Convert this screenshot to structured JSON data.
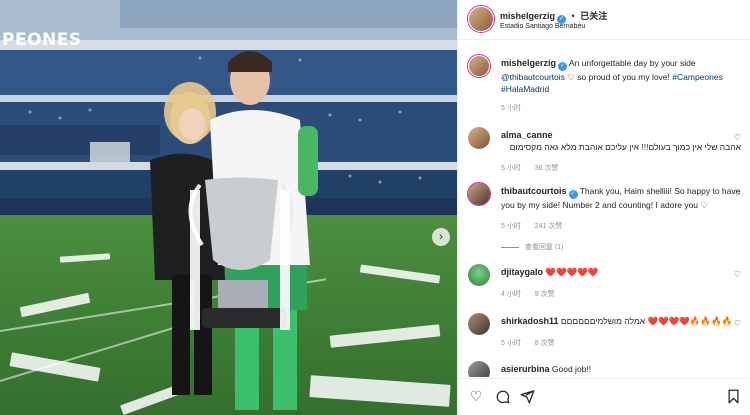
{
  "header": {
    "username": "mishelgerzig",
    "follow_label": "已关注",
    "location": "Estadio Santiago Bernabéu"
  },
  "photo": {
    "banner_text": "PEONES"
  },
  "caption": {
    "username": "mishelgerzig",
    "text": "An unforgettable day by your side",
    "mention": "@thibautcourtois",
    "text2": "so proud of you my love!",
    "hashtag1": "#Campeones",
    "hashtag2": "#HalaMadrid",
    "time": "5 小时"
  },
  "comments": [
    {
      "username": "alma_canne",
      "text": "אהבה שלי אין כמוך בעולם!!! אין עליכם אוהבת מלא גאה מקסימום",
      "time": "5 小时",
      "likes": "36 次赞"
    },
    {
      "username": "thibautcourtois",
      "text": "Thank you, Haim shelliii! So happy to have you by my side! Number 2 and counting! I adore you",
      "time": "5 小时",
      "likes": "241 次赞",
      "replies": "查看回复 (1)"
    },
    {
      "username": "djitaygalo",
      "text": "❤️❤️❤️❤️❤️",
      "time": "4 小时",
      "likes": "9 次赞"
    },
    {
      "username": "shirkadosh11",
      "text": "אמלה מושלמיםםםםםם ❤️❤️❤️❤️🔥🔥🔥🔥",
      "time": "5 小时",
      "likes": "8 次赞"
    },
    {
      "username": "asierurbina",
      "text": "Good job!!"
    }
  ],
  "colors": {
    "verified": "#3897f0",
    "link": "#00376b",
    "muted": "#8e8e8e"
  },
  "icons": [
    "heart-icon",
    "comment-icon",
    "share-icon",
    "bookmark-icon",
    "verified-icon",
    "slide-next-icon"
  ]
}
